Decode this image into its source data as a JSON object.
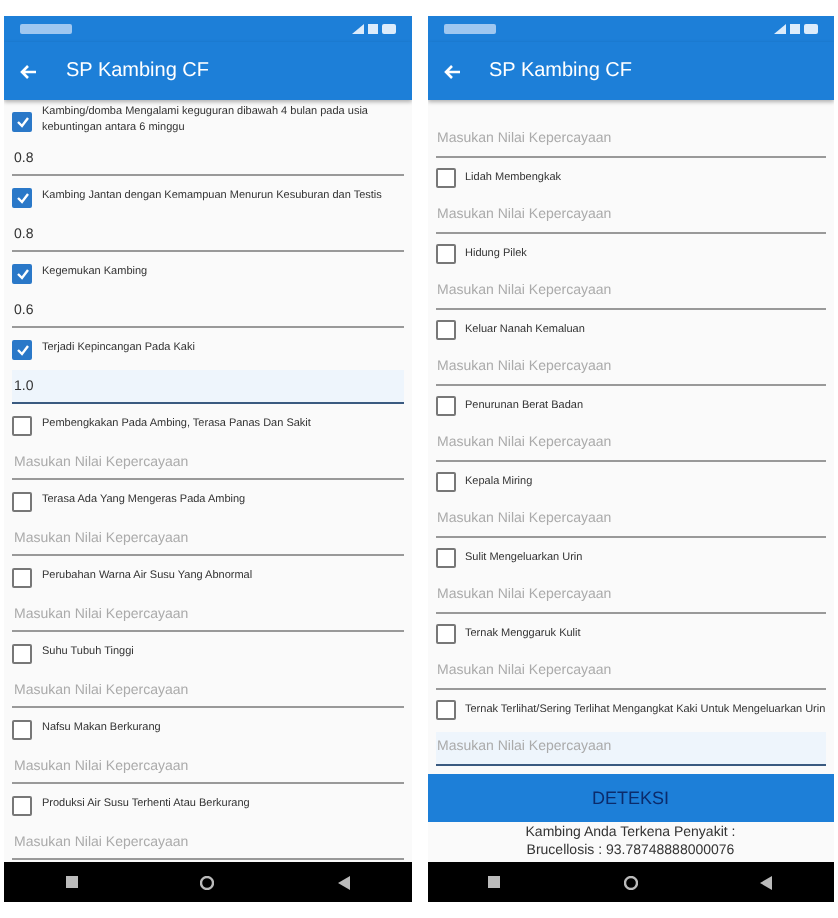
{
  "screens": [
    {
      "app_bar": {
        "title": "SP Kambing CF"
      },
      "symptoms": [
        {
          "label": "Kambing/domba Mengalami keguguran dibawah 4 bulan pada usia kebuntingan antara 6 minggu",
          "checked": true,
          "value": "0.8",
          "focused": false
        },
        {
          "label": "Kambing Jantan dengan Kemampuan Menurun Kesuburan dan Testis",
          "checked": true,
          "value": "0.8",
          "focused": false
        },
        {
          "label": "Kegemukan Kambing",
          "checked": true,
          "value": "0.6",
          "focused": false
        },
        {
          "label": "Terjadi Kepincangan Pada Kaki",
          "checked": true,
          "value": "1.0",
          "focused": true
        },
        {
          "label": "Pembengkakan Pada Ambing, Terasa Panas Dan Sakit",
          "checked": false,
          "placeholder": "Masukan Nilai Kepercayaan",
          "focused": false
        },
        {
          "label": "Terasa Ada Yang Mengeras Pada Ambing",
          "checked": false,
          "placeholder": "Masukan Nilai Kepercayaan",
          "focused": false
        },
        {
          "label": "Perubahan Warna Air Susu Yang Abnormal",
          "checked": false,
          "placeholder": "Masukan Nilai Kepercayaan",
          "focused": false
        },
        {
          "label": "Suhu Tubuh Tinggi",
          "checked": false,
          "placeholder": "Masukan Nilai Kepercayaan",
          "focused": false
        },
        {
          "label": "Nafsu Makan Berkurang",
          "checked": false,
          "placeholder": "Masukan Nilai Kepercayaan",
          "focused": false
        },
        {
          "label": "Produksi Air Susu Terhenti Atau Berkurang",
          "checked": false,
          "placeholder": "Masukan Nilai Kepercayaan",
          "focused": false
        }
      ]
    },
    {
      "app_bar": {
        "title": "SP Kambing CF"
      },
      "symptoms": [
        {
          "placeholder": "Masukan Nilai Kepercayaan",
          "focused": false
        },
        {
          "label": "Lidah Membengkak",
          "checked": false,
          "placeholder": "Masukan Nilai Kepercayaan",
          "focused": false
        },
        {
          "label": "Hidung Pilek",
          "checked": false,
          "placeholder": "Masukan Nilai Kepercayaan",
          "focused": false
        },
        {
          "label": "Keluar Nanah Kemaluan",
          "checked": false,
          "placeholder": "Masukan Nilai Kepercayaan",
          "focused": false
        },
        {
          "label": "Penurunan Berat Badan",
          "checked": false,
          "placeholder": "Masukan Nilai Kepercayaan",
          "focused": false
        },
        {
          "label": "Kepala Miring",
          "checked": false,
          "placeholder": "Masukan Nilai Kepercayaan",
          "focused": false
        },
        {
          "label": "Sulit Mengeluarkan Urin",
          "checked": false,
          "placeholder": "Masukan Nilai Kepercayaan",
          "focused": false
        },
        {
          "label": "Ternak Menggaruk Kulit",
          "checked": false,
          "placeholder": "Masukan Nilai Kepercayaan",
          "focused": false
        },
        {
          "label": "Ternak Terlihat/Sering Terlihat Mengangkat Kaki Untuk Mengeluarkan Urin",
          "checked": false,
          "placeholder": "Masukan Nilai Kepercayaan",
          "focused": true
        }
      ],
      "detect_button": "DETEKSI",
      "result": [
        "Kambing Anda Terkena Penyakit :",
        "Brucellosis : 93.78748888000076"
      ]
    }
  ]
}
